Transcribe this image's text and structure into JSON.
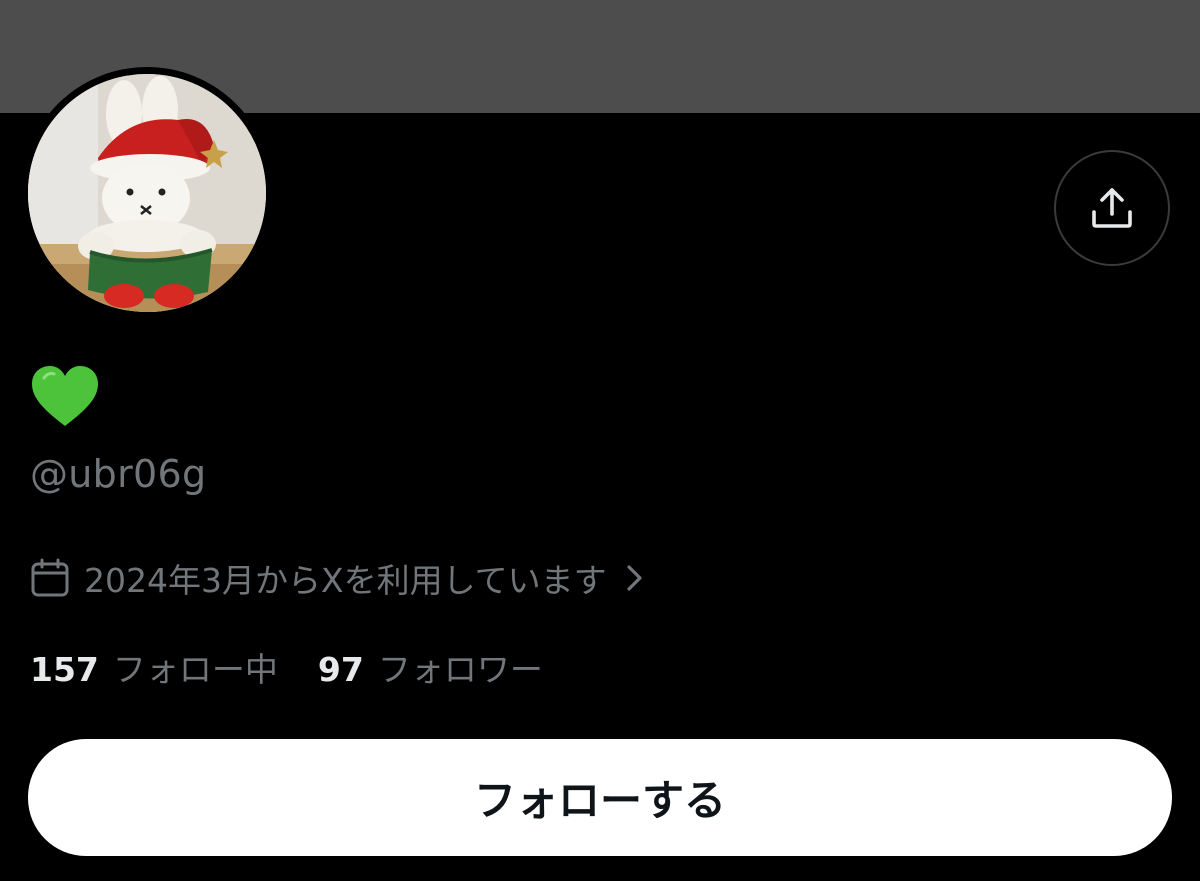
{
  "profile": {
    "display_name": "💚",
    "handle": "@ubr06g",
    "joined_text": "2024年3月からXを利用しています",
    "following_count": "157",
    "following_label": "フォロー中",
    "followers_count": "97",
    "followers_label": "フォロワー"
  },
  "actions": {
    "follow_label": "フォローする"
  },
  "icons": {
    "share": "share-upload-icon",
    "calendar": "calendar-icon",
    "chevron": "chevron-right-icon",
    "display_name_emoji": "green-heart-icon"
  },
  "colors": {
    "background": "#000000",
    "banner": "#4d4d4d",
    "primary_text": "#e7e9ea",
    "secondary_text": "#71767b",
    "follow_button_bg": "#ffffff",
    "follow_button_text": "#0f1419",
    "heart": "#4cc33a"
  }
}
